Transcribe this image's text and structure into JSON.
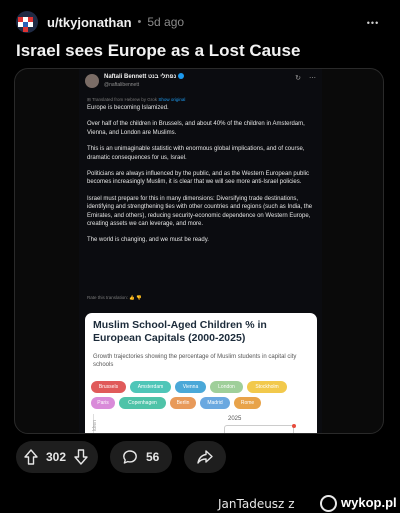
{
  "post": {
    "author": "u/tkyjonathan",
    "separator": "•",
    "age": "5d ago",
    "more_label": "•••",
    "title": "Israel sees Europe as a Lost Cause"
  },
  "tweet": {
    "name": "Naftali Bennett נפתלי בנט",
    "handle": "@naftalibennett",
    "translated_note": "Translated from Hebrew by Grok",
    "show_original": "Show original",
    "paragraphs": [
      "Europe is becoming Islamized.",
      "Over half of the children in Brussels, and about 40% of the children in Amsterdam, Vienna, and London are Muslims.",
      "This is an unimaginable statistic with enormous global implications, and of course, dramatic consequences for us, Israel.",
      "Politicians are always influenced by the public, and as the Western European public becomes increasingly Muslim, it is clear that we will see more anti-Israel policies.",
      "Israel must prepare for this in many dimensions: Diversifying trade destinations, identifying and strengthening ties with other countries and regions (such as India, the Emirates, and others), reducing security-economic dependence on Western Europe, creating assets we can leverage, and more.",
      "The world is changing, and we must be ready."
    ],
    "rate_label": "Rate this translation:"
  },
  "chart_card": {
    "title": "Muslim School-Aged Children % in European Capitals (2000-2025)",
    "subtitle": "Growth trajectories showing the percentage of Muslim students in capital city schools",
    "cities": [
      {
        "name": "Brussels",
        "color": "#e05a5a"
      },
      {
        "name": "Amsterdam",
        "color": "#4fc6b8"
      },
      {
        "name": "Vienna",
        "color": "#4aa8d8"
      },
      {
        "name": "London",
        "color": "#9fcf9a"
      },
      {
        "name": "Stockholm",
        "color": "#f2c94c"
      },
      {
        "name": "Paris",
        "color": "#d98bd9"
      },
      {
        "name": "Copenhagen",
        "color": "#4fc3a8"
      },
      {
        "name": "Berlin",
        "color": "#e89a5a"
      },
      {
        "name": "Madrid",
        "color": "#6aa8e0"
      },
      {
        "name": "Rome",
        "color": "#e8a34a"
      }
    ],
    "y_label": "ldren",
    "tooltip_year": "2025"
  },
  "actions": {
    "score": "302",
    "comments": "56"
  },
  "watermark": {
    "user": "JanTadeusz",
    "connector": "z",
    "brand": "wykop.pl"
  }
}
